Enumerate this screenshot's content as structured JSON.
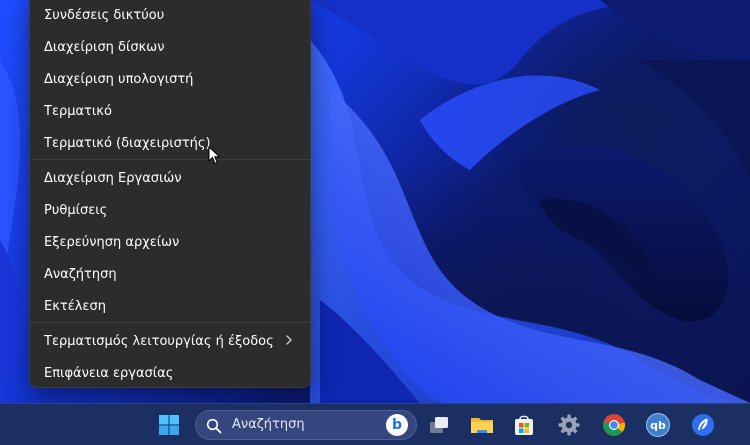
{
  "menu": {
    "items": [
      {
        "label": "Συνδέσεις δικτύου"
      },
      {
        "label": "Διαχείριση δίσκων"
      },
      {
        "label": "Διαχείριση υπολογιστή"
      },
      {
        "label": "Τερματικό"
      },
      {
        "label": "Τερματικό (διαχειριστής)"
      },
      {
        "label": "Διαχείριση Εργασιών"
      },
      {
        "label": "Ρυθμίσεις"
      },
      {
        "label": "Εξερεύνηση αρχείων"
      },
      {
        "label": "Αναζήτηση"
      },
      {
        "label": "Εκτέλεση"
      },
      {
        "label": "Τερματισμός λειτουργίας ή έξοδος",
        "submenu": true
      },
      {
        "label": "Επιφάνεια εργασίας"
      }
    ]
  },
  "taskbar": {
    "search_placeholder": "Αναζήτηση",
    "qbittorrent_text": "qb",
    "bing_text": "b",
    "icons": [
      "windows-start-icon",
      "search-icon",
      "bing-icon",
      "task-view-icon",
      "file-explorer-icon",
      "microsoft-store-icon",
      "settings-gear-icon",
      "chrome-icon",
      "qbittorrent-icon",
      "feather-app-icon"
    ]
  },
  "colors": {
    "menu_bg": "#2c2c2c",
    "taskbar_bg": "#1b2f63",
    "accent": "#1f4dff"
  }
}
